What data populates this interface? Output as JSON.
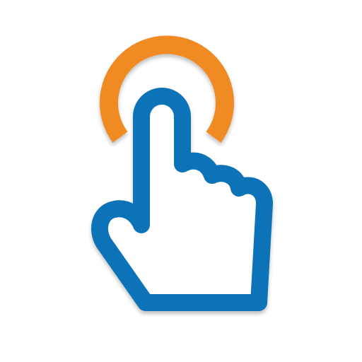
{
  "icon": {
    "name": "tap-gesture-icon",
    "parts": [
      "touch-ring",
      "pointing-hand"
    ]
  },
  "colors": {
    "background": "#ffffff",
    "ring": "#f08a24",
    "hand_outline": "#0e73b9",
    "hand_fill": "#ffffff",
    "shadow": "#000000"
  }
}
